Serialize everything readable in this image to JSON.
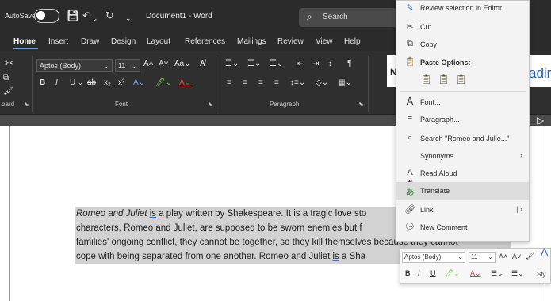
{
  "titlebar": {
    "autosave": "AutoSave",
    "autosave_state": "Off",
    "doc_title": "Document1 - Word",
    "search_placeholder": "Search"
  },
  "tabs": [
    "Home",
    "Insert",
    "Draw",
    "Design",
    "Layout",
    "References",
    "Mailings",
    "Review",
    "View",
    "Help"
  ],
  "ribbon": {
    "font_name": "Aptos (Body)",
    "font_size": "11",
    "groups": {
      "clipboard": "oard",
      "font": "Font",
      "paragraph": "Paragraph"
    },
    "styles_partial": "adir"
  },
  "document": {
    "lines": [
      {
        "italic": "Romeo and Juliet",
        "rest_before": " ",
        "ul": "is",
        "rest": " a play written by Shakespeare. It is a tragic love sto"
      },
      {
        "text": "characters, Romeo and Juliet, are supposed to be sworn enemies but f"
      },
      {
        "text": "families' ongoing conflict, they cannot be together, so they kill themselves because they cannot"
      },
      {
        "pre": "cope with being separated from one another. Romeo and Juliet ",
        "ul": "is",
        "post": " a Sha"
      }
    ]
  },
  "context_menu": {
    "items": [
      {
        "label": "Review selection in Editor",
        "icon": "editor-icon"
      },
      {
        "label": "Cut",
        "icon": "scissors-icon"
      },
      {
        "label": "Copy",
        "icon": "copy-icon"
      },
      {
        "label": "Font...",
        "icon": "font-icon"
      },
      {
        "label": "Paragraph...",
        "icon": "paragraph-icon"
      },
      {
        "label": "Search \"Romeo and Julie...\"",
        "icon": "search-icon"
      },
      {
        "label": "Synonyms",
        "icon": ""
      },
      {
        "label": "Read Aloud",
        "icon": "read-aloud-icon"
      },
      {
        "label": "Translate",
        "icon": "translate-icon"
      },
      {
        "label": "Link",
        "icon": "link-icon"
      },
      {
        "label": "New Comment",
        "icon": "comment-icon"
      }
    ],
    "paste_options_label": "Paste Options:"
  },
  "mini_toolbar": {
    "font_name": "Aptos (Body)",
    "font_size": "11",
    "styles_partial": "Sty"
  },
  "colors": {
    "titlebar": "#2b2b2b",
    "ribbon": "#2f2f2f",
    "accent": "#6aa7f0",
    "selection": "#d2d2d2",
    "menu_hover": "#dcdcdc"
  }
}
